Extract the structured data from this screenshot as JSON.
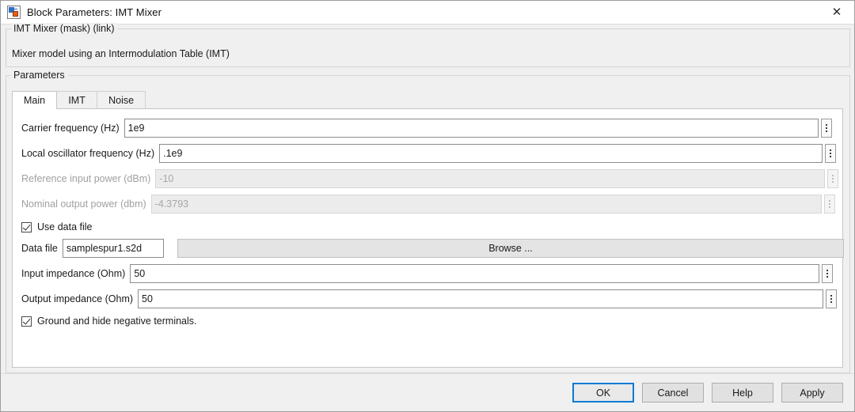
{
  "window": {
    "title": "Block Parameters: IMT Mixer",
    "icon": "simulink-block-icon",
    "close_label": "✕"
  },
  "description": {
    "legend": "IMT Mixer (mask) (link)",
    "text": "Mixer model using an Intermodulation Table (IMT)"
  },
  "parameters": {
    "legend": "Parameters",
    "tabs": [
      {
        "label": "Main",
        "active": true
      },
      {
        "label": "IMT",
        "active": false
      },
      {
        "label": "Noise",
        "active": false
      }
    ],
    "fields": [
      {
        "label": "Carrier frequency (Hz)",
        "value": "1e9",
        "disabled": false,
        "stepper": true
      },
      {
        "label": "Local oscillator frequency (Hz)",
        "value": ".1e9",
        "disabled": false,
        "stepper": true
      },
      {
        "label": "Reference input power (dBm)",
        "value": "-10",
        "disabled": true,
        "stepper": true
      },
      {
        "label": "Nominal output power (dbm)",
        "value": "-4.3793",
        "disabled": true,
        "stepper": true
      }
    ],
    "use_data_file": {
      "label": "Use data file",
      "checked": true
    },
    "data_file": {
      "label": "Data file",
      "value": "samplespur1.s2d",
      "browse_label": "Browse ..."
    },
    "impedance": [
      {
        "label": "Input impedance (Ohm)",
        "value": "50",
        "stepper": true
      },
      {
        "label": "Output impedance (Ohm)",
        "value": "50",
        "stepper": true
      }
    ],
    "ground_hide": {
      "label": "Ground and hide negative terminals.",
      "checked": true
    }
  },
  "footer": {
    "ok": "OK",
    "cancel": "Cancel",
    "help": "Help",
    "apply": "Apply"
  },
  "colors": {
    "accent": "#0a7ad6",
    "window_bg": "#f0f0f0",
    "panel_bg": "#ffffff",
    "disabled_text": "#a7a7a7"
  }
}
